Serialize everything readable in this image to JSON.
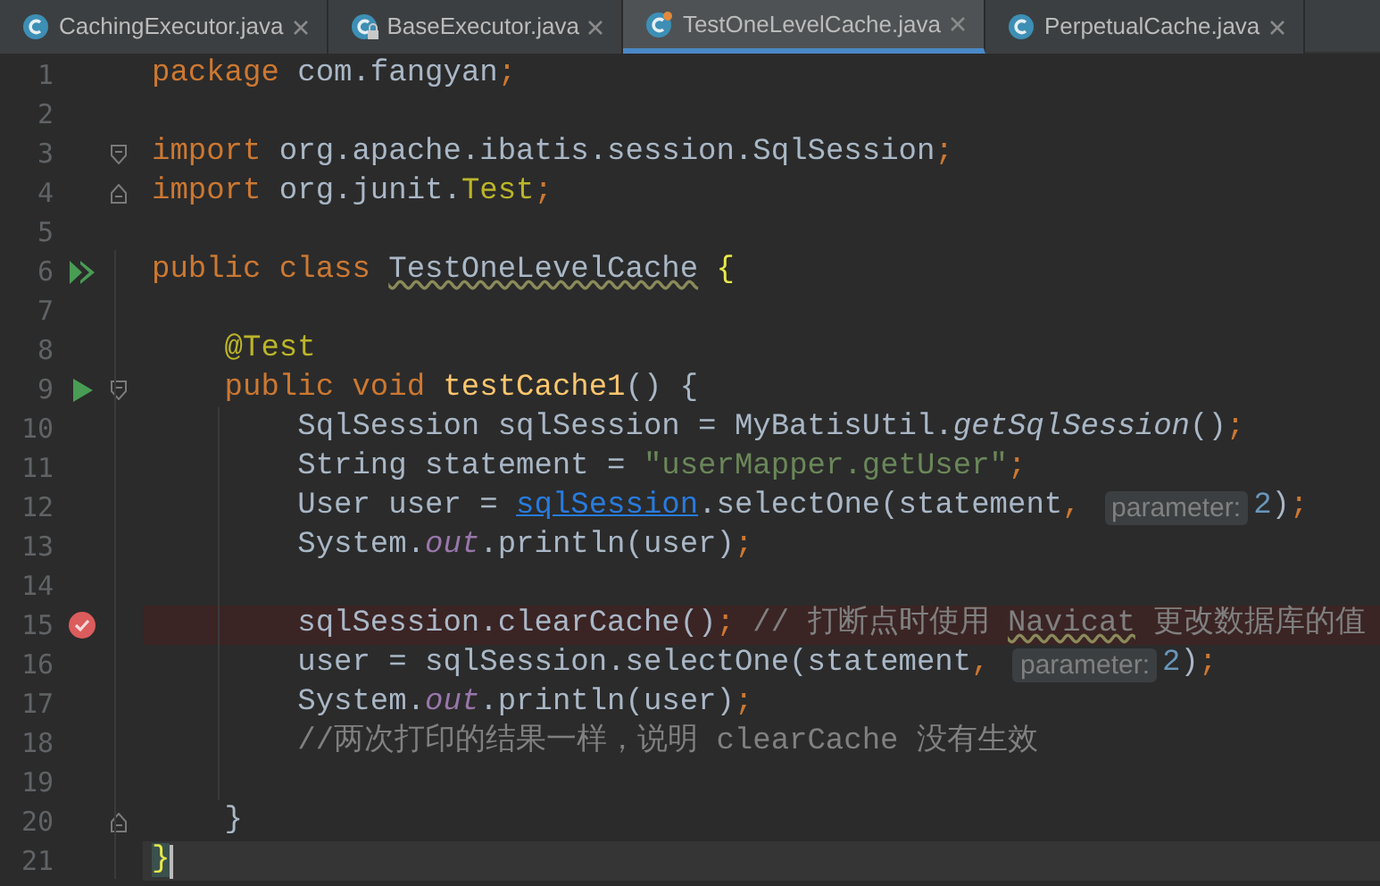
{
  "tabs": [
    {
      "label": "CachingExecutor.java",
      "selected": false,
      "locked": false,
      "modified": false
    },
    {
      "label": "BaseExecutor.java",
      "selected": false,
      "locked": true,
      "modified": false
    },
    {
      "label": "TestOneLevelCache.java",
      "selected": true,
      "locked": false,
      "modified": true
    },
    {
      "label": "PerpetualCache.java",
      "selected": false,
      "locked": false,
      "modified": false
    }
  ],
  "lines": [
    {
      "number": "1",
      "breakpoint": false,
      "current": false,
      "tokens": [
        {
          "text": "package ",
          "kind": "keyword"
        },
        {
          "text": "com.fangyan",
          "kind": "plain"
        },
        {
          "text": ";",
          "kind": "keyword"
        }
      ]
    },
    {
      "number": "2",
      "breakpoint": false,
      "current": false
    },
    {
      "number": "3",
      "breakpoint": false,
      "current": false,
      "gutter": [
        {
          "kind": "fold-start"
        }
      ],
      "tokens": [
        {
          "text": "import ",
          "kind": "keyword"
        },
        {
          "text": "org.apache.ibatis.session.SqlSession",
          "kind": "plain"
        },
        {
          "text": ";",
          "kind": "keyword"
        }
      ]
    },
    {
      "number": "4",
      "breakpoint": false,
      "current": false,
      "gutter": [
        {
          "kind": "fold-end"
        }
      ],
      "tokens": [
        {
          "text": "import ",
          "kind": "keyword"
        },
        {
          "text": "org.junit.",
          "kind": "plain"
        },
        {
          "text": "Test",
          "kind": "annotation"
        },
        {
          "text": ";",
          "kind": "keyword"
        }
      ]
    },
    {
      "number": "5",
      "breakpoint": false,
      "current": false
    },
    {
      "number": "6",
      "breakpoint": false,
      "current": false,
      "gutter": [
        {
          "kind": "run-all"
        }
      ],
      "tokens": [
        {
          "text": "public class ",
          "kind": "keyword"
        },
        {
          "text": "TestOneLevelCache",
          "kind": "warning"
        },
        {
          "text": " {",
          "kind": "brace"
        }
      ]
    },
    {
      "number": "7",
      "breakpoint": false,
      "current": false
    },
    {
      "number": "8",
      "breakpoint": false,
      "current": false,
      "tokens": [
        {
          "text": "    @Test",
          "kind": "annotation"
        }
      ]
    },
    {
      "number": "9",
      "breakpoint": false,
      "current": false,
      "gutter": [
        {
          "kind": "run"
        },
        {
          "kind": "fold-start"
        }
      ],
      "tokens": [
        {
          "text": "    public void ",
          "kind": "keyword"
        },
        {
          "text": "testCache1",
          "kind": "method"
        },
        {
          "text": "() {",
          "kind": "plain"
        }
      ]
    },
    {
      "number": "10",
      "breakpoint": false,
      "current": false,
      "tokens": [
        {
          "text": "        SqlSession sqlSession = MyBatisUtil.",
          "kind": "plain"
        },
        {
          "text": "getSqlSession",
          "kind": "static"
        },
        {
          "text": "()",
          "kind": "plain"
        },
        {
          "text": ";",
          "kind": "keyword"
        }
      ]
    },
    {
      "number": "11",
      "breakpoint": false,
      "current": false,
      "tokens": [
        {
          "text": "        String statement = ",
          "kind": "plain"
        },
        {
          "text": "\"userMapper.getUser\"",
          "kind": "string"
        },
        {
          "text": ";",
          "kind": "keyword"
        }
      ]
    },
    {
      "number": "12",
      "breakpoint": false,
      "current": false,
      "tokens": [
        {
          "text": "        User user = ",
          "kind": "plain"
        },
        {
          "text": "sqlSession",
          "kind": "link"
        },
        {
          "text": ".selectOne(statement",
          "kind": "plain"
        },
        {
          "text": ", ",
          "kind": "keyword"
        },
        {
          "text": "parameter:",
          "kind": "hint"
        },
        {
          "text": "2",
          "kind": "number"
        },
        {
          "text": ")",
          "kind": "plain"
        },
        {
          "text": ";",
          "kind": "keyword"
        }
      ]
    },
    {
      "number": "13",
      "breakpoint": false,
      "current": false,
      "tokens": [
        {
          "text": "        System.",
          "kind": "plain"
        },
        {
          "text": "out",
          "kind": "field"
        },
        {
          "text": ".println(user)",
          "kind": "plain"
        },
        {
          "text": ";",
          "kind": "keyword"
        }
      ]
    },
    {
      "number": "14",
      "breakpoint": false,
      "current": false
    },
    {
      "number": "15",
      "breakpoint": true,
      "current": false,
      "tokens": [
        {
          "text": "        sqlSession.clearCache()",
          "kind": "plain"
        },
        {
          "text": "; ",
          "kind": "keyword"
        },
        {
          "text": "// 打断点时使用 ",
          "kind": "comment"
        },
        {
          "text": "Navicat",
          "kind": "comment-warning"
        },
        {
          "text": " 更改数据库的值",
          "kind": "comment"
        }
      ]
    },
    {
      "number": "16",
      "breakpoint": false,
      "current": false,
      "tokens": [
        {
          "text": "        user = sqlSession.selectOne(statement",
          "kind": "plain"
        },
        {
          "text": ", ",
          "kind": "keyword"
        },
        {
          "text": "parameter:",
          "kind": "hint"
        },
        {
          "text": "2",
          "kind": "number"
        },
        {
          "text": ")",
          "kind": "plain"
        },
        {
          "text": ";",
          "kind": "keyword"
        }
      ]
    },
    {
      "number": "17",
      "breakpoint": false,
      "current": false,
      "tokens": [
        {
          "text": "        System.",
          "kind": "plain"
        },
        {
          "text": "out",
          "kind": "field"
        },
        {
          "text": ".println(user)",
          "kind": "plain"
        },
        {
          "text": ";",
          "kind": "keyword"
        }
      ]
    },
    {
      "number": "18",
      "breakpoint": false,
      "current": false,
      "tokens": [
        {
          "text": "        //两次打印的结果一样，说明 clearCache 没有生效",
          "kind": "comment"
        }
      ]
    },
    {
      "number": "19",
      "breakpoint": false,
      "current": false
    },
    {
      "number": "20",
      "breakpoint": false,
      "current": false,
      "gutter": [
        {
          "kind": "fold-end"
        }
      ],
      "tokens": [
        {
          "text": "    }",
          "kind": "plain"
        }
      ]
    },
    {
      "number": "21",
      "breakpoint": false,
      "current": true,
      "tokens": [
        {
          "text": "}",
          "kind": "brace"
        }
      ]
    }
  ]
}
